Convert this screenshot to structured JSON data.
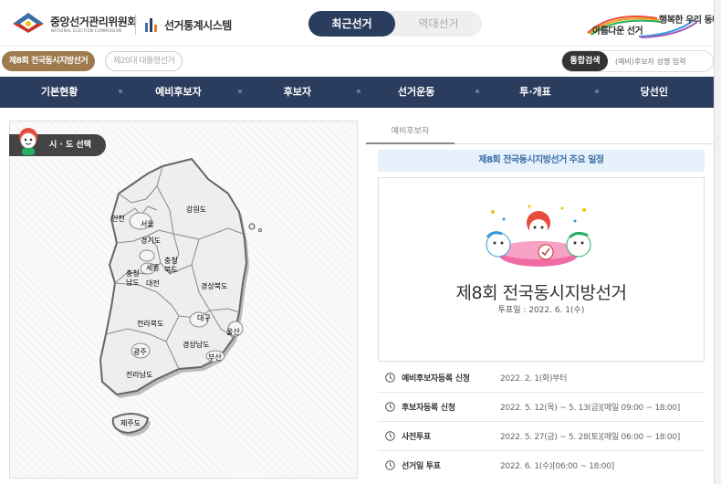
{
  "header": {
    "org_name": "중앙선거관리위원회",
    "org_sub": "NATIONAL ELECTION COMMISSION",
    "system_name": "선거통계시스템",
    "toggle": {
      "active": "최근선거",
      "inactive": "역대선거"
    },
    "slogan_left": "아름다운 선거",
    "slogan_right": "행복한 우리 동네"
  },
  "election_tabs": [
    {
      "label": "제8회 전국동시지방선거",
      "active": true
    },
    {
      "label": "제20대 대통령선거",
      "active": false
    }
  ],
  "search": {
    "button_label": "통합검색",
    "placeholder": "(예비)후보자 성명 입력"
  },
  "nav": {
    "items": [
      "기본현황",
      "예비후보자",
      "후보자",
      "선거운동",
      "투·개표",
      "당선인"
    ]
  },
  "map_panel": {
    "select_label": "시 · 도 선택",
    "regions": {
      "incheon": "인천",
      "seoul": "서울",
      "gyeonggi": "경기도",
      "gangwon": "강원도",
      "chungbuk_1": "충청",
      "chungbuk_2": "북도",
      "chungnam_1": "충청",
      "chungnam_2": "남도",
      "sejong": "세종",
      "daejeon": "대전",
      "gyeongbuk": "경상북도",
      "jeonbuk": "전라북도",
      "daegu": "대구",
      "ulsan": "울산",
      "gwangju": "광주",
      "gyeongnam": "경상남도",
      "busan": "부산",
      "jeonnam": "전라남도",
      "jeju": "제주도"
    }
  },
  "right_panel": {
    "tab_label": "예비후보자",
    "banner": "제8회 전국동시지방선거 주요 일정",
    "election_title": "제8회 전국동시지방선거",
    "vote_date": "투표일 : 2022. 6. 1(수)",
    "schedule": [
      {
        "label": "예비후보자등록 신청",
        "value": "2022. 2. 1(화)부터"
      },
      {
        "label": "후보자등록 신청",
        "value": "2022. 5. 12(목) ~ 5. 13(금)[매일 09:00 ~ 18:00]"
      },
      {
        "label": "사전투표",
        "value": "2022. 5. 27(금) ~ 5. 28(토)[매일 06:00 ~ 18:00]"
      },
      {
        "label": "선거일 투표",
        "value": "2022. 6. 1(수)[06:00 ~ 18:00]"
      }
    ]
  },
  "colors": {
    "navy": "#2b3d5f",
    "gold": "#9e7a4d",
    "banner_bg": "#e7f1fb",
    "banner_text": "#3a6ea5"
  }
}
